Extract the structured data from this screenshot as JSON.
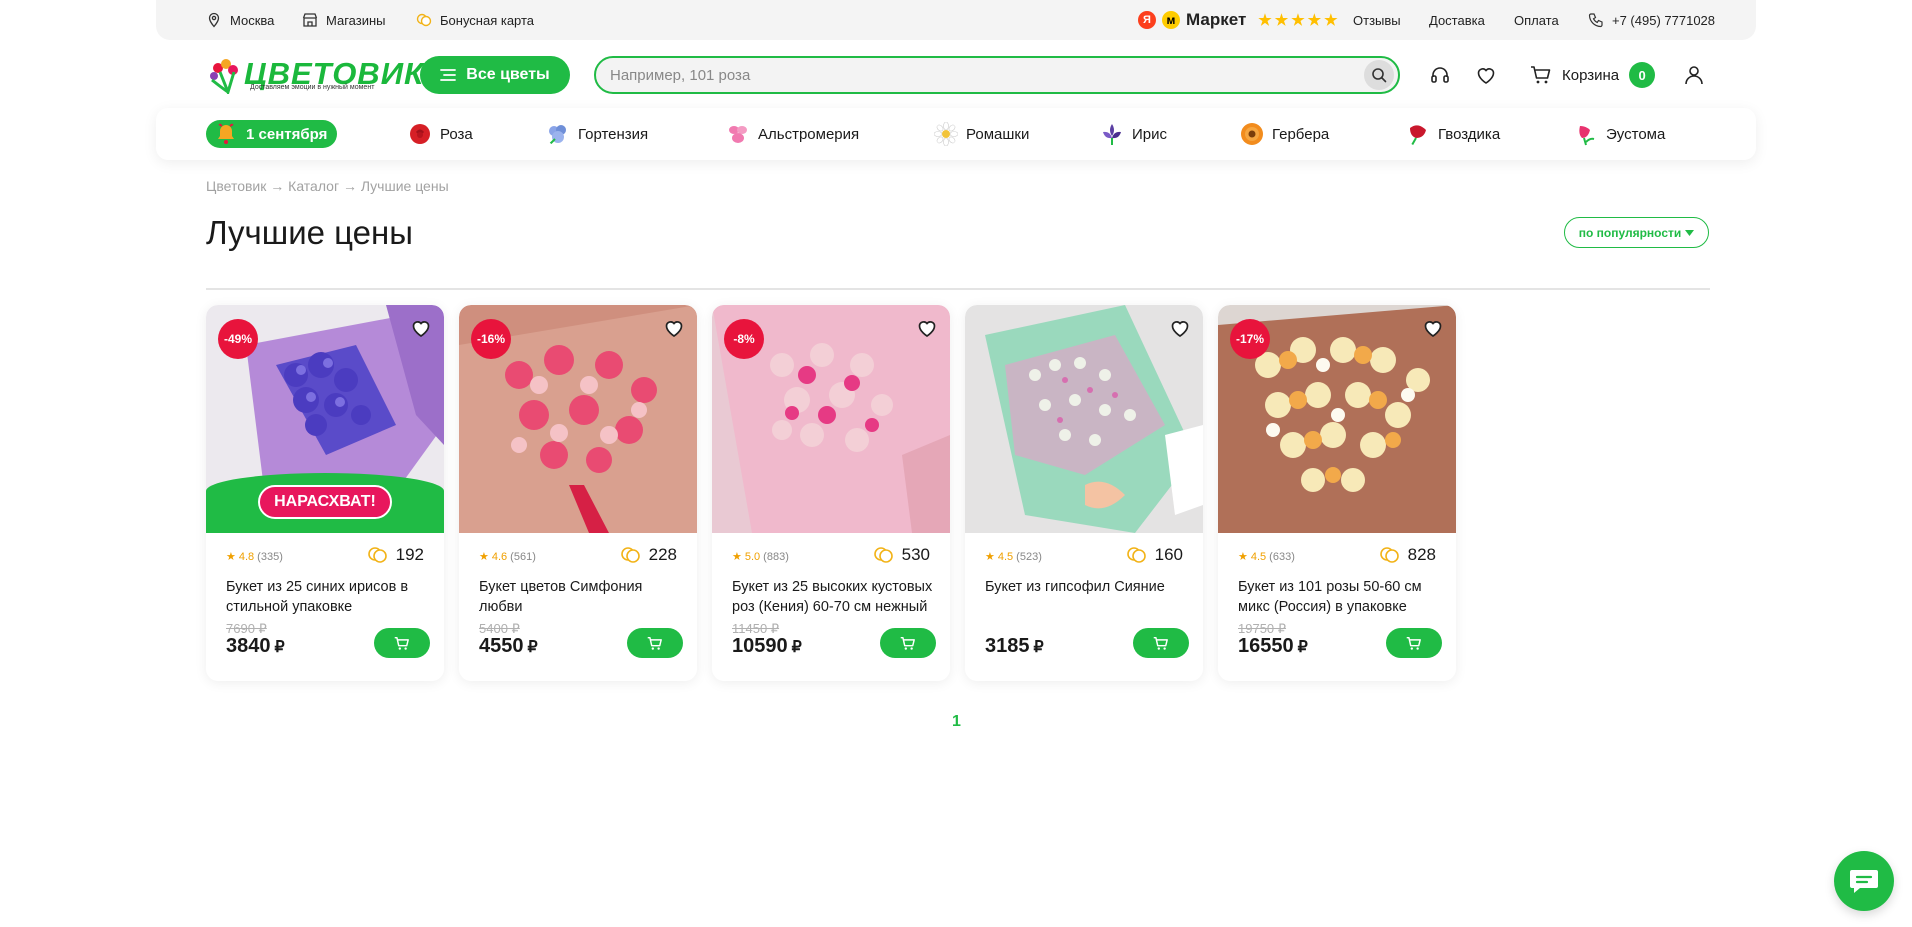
{
  "topbar": {
    "city": "Москва",
    "stores": "Магазины",
    "bonus_card": "Бонусная карта",
    "market_label": "Маркет",
    "market_rating": 5,
    "reviews": "Отзывы",
    "delivery": "Доставка",
    "payment": "Оплата",
    "phone": "+7 (495) 7771028"
  },
  "header": {
    "logo_text": "ЦВЕТОВИК",
    "logo_tagline": "Доставляем эмоции в нужный момент",
    "all_flowers": "Все цветы",
    "search_placeholder": "Например, 101 роза",
    "cart_label": "Корзина",
    "cart_count": "0"
  },
  "categories": [
    {
      "label": "1 сентября",
      "icon": "bell-icon",
      "color": "#f5a623"
    },
    {
      "label": "Роза",
      "icon": "rose-icon",
      "color": "#d61f26"
    },
    {
      "label": "Гортензия",
      "icon": "hydrangea-icon",
      "color": "#6f8fd8"
    },
    {
      "label": "Альстромерия",
      "icon": "alstroemeria-icon",
      "color": "#f17ab0"
    },
    {
      "label": "Ромашки",
      "icon": "daisy-icon",
      "color": "#f2c43b"
    },
    {
      "label": "Ирис",
      "icon": "iris-icon",
      "color": "#5b3fa3"
    },
    {
      "label": "Гербера",
      "icon": "gerbera-icon",
      "color": "#f28c1d"
    },
    {
      "label": "Гвоздика",
      "icon": "carnation-icon",
      "color": "#c9182d"
    },
    {
      "label": "Эустома",
      "icon": "eustoma-icon",
      "color": "#e8336f"
    }
  ],
  "breadcrumb": "Цветовик → Каталог → Лучшие цены",
  "page_title": "Лучшие цены",
  "sort_label": "по популярности",
  "products": [
    {
      "discount": "-49%",
      "hot_label": "НАРАСХВАТ!",
      "rating": "4.8",
      "reviews": "(335)",
      "bonus": "192",
      "name": "Букет из 25 синих ирисов в стильной упаковке",
      "old_price": "7690 ₽",
      "price": "3840",
      "currency": "₽",
      "theme": "iris"
    },
    {
      "discount": "-16%",
      "rating": "4.6",
      "reviews": "(561)",
      "bonus": "228",
      "name": "Букет цветов Симфония любви",
      "old_price": "5400 ₽",
      "price": "4550",
      "currency": "₽",
      "theme": "pink"
    },
    {
      "discount": "-8%",
      "rating": "5.0",
      "reviews": "(883)",
      "bonus": "530",
      "name": "Букет из 25 высоких кустовых роз (Кения) 60-70 см нежный",
      "old_price": "11450 ₽",
      "price": "10590",
      "currency": "₽",
      "theme": "spray"
    },
    {
      "discount": "",
      "rating": "4.5",
      "reviews": "(523)",
      "bonus": "160",
      "name": "Букет из гипсофил Сияние",
      "old_price": "",
      "price": "3185",
      "currency": "₽",
      "theme": "gyps"
    },
    {
      "discount": "-17%",
      "rating": "4.5",
      "reviews": "(633)",
      "bonus": "828",
      "name": "Букет из 101 розы 50-60 см микс (Россия) в упаковке",
      "old_price": "19750 ₽",
      "price": "16550",
      "currency": "₽",
      "theme": "mix"
    }
  ],
  "pagination": {
    "current": "1"
  },
  "colors": {
    "brand": "#20bb45",
    "discount": "#e8143c",
    "hot": "#e8175d"
  }
}
